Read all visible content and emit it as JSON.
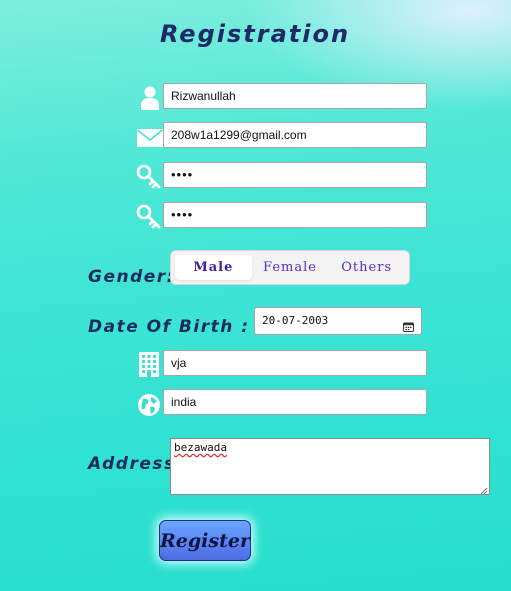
{
  "form": {
    "title": "Registration",
    "username": {
      "value": "Rizwanullah",
      "icon": "user-icon"
    },
    "email": {
      "value": "208w1a1299@gmail.com",
      "icon": "envelope-icon"
    },
    "password": {
      "value": "••••",
      "icon": "key-icon"
    },
    "confirm_password": {
      "value": "••••",
      "icon": "key-icon"
    },
    "gender": {
      "label": "Gender:",
      "options": [
        "Male",
        "Female",
        "Others"
      ],
      "selected": "Male"
    },
    "dob": {
      "label": "Date Of Birth :",
      "value": "20-07-2003",
      "icon": "calendar-icon"
    },
    "city": {
      "value": "vja",
      "icon": "building-icon"
    },
    "country": {
      "value": "india",
      "icon": "globe-icon"
    },
    "address": {
      "label": "Address",
      "value": "bezawada"
    },
    "register_label": "Register"
  },
  "colors": {
    "title": "#1f2a66",
    "label": "#1c2a5e",
    "gender_text": "#5b2cc4",
    "button": "#5a82f3",
    "background": "#3de4d4"
  }
}
